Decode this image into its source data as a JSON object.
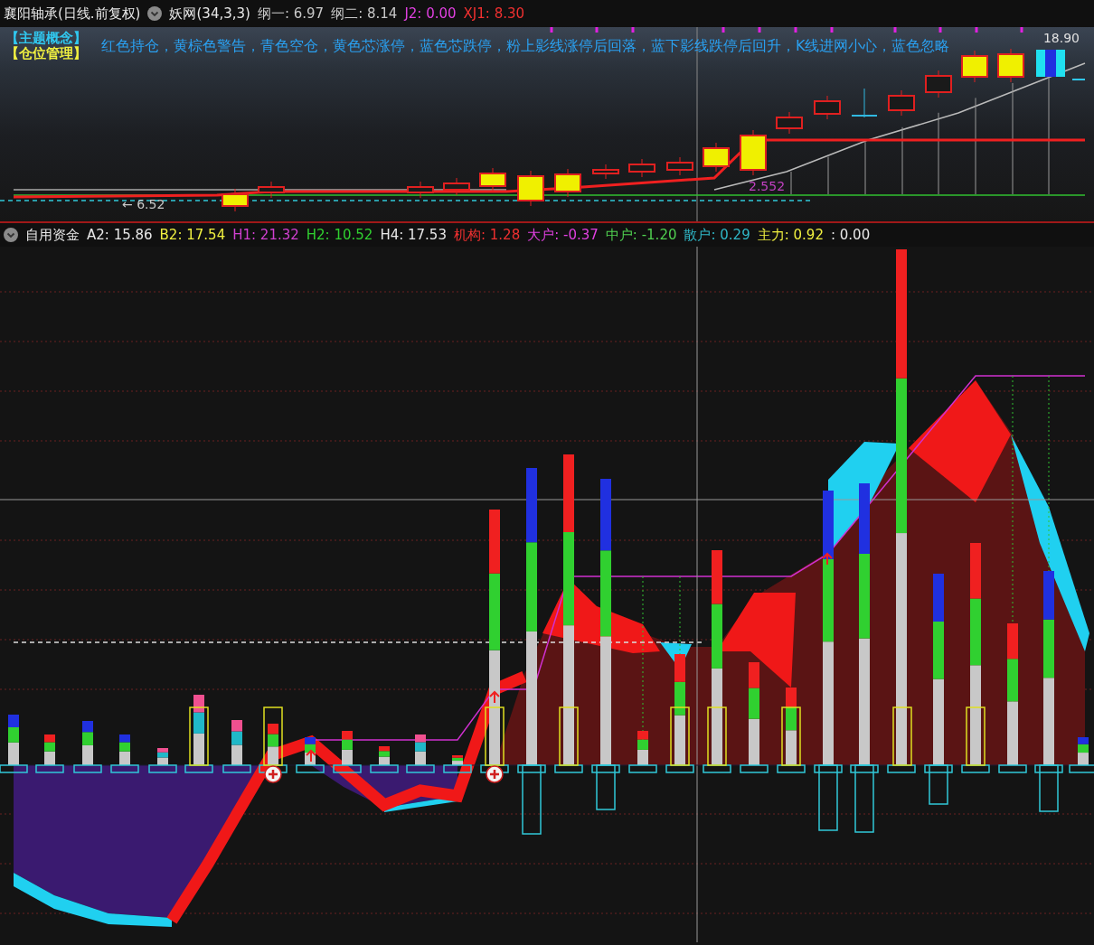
{
  "header": {
    "stock": "襄阳轴承(日线.前复权)",
    "indicator": "妖网(34,3,3)",
    "values": [
      {
        "text": "纲一: 6.97",
        "color": "#c8c8c8"
      },
      {
        "text": "纲二: 8.14",
        "color": "#c8c8c8"
      },
      {
        "text": "J2: 0.00",
        "color": "#e040e0"
      },
      {
        "text": "XJ1: 8.30",
        "color": "#f03030"
      }
    ]
  },
  "price_pane": {
    "legend_tags": [
      {
        "text": "【主题概念】",
        "color": "#30c8f0"
      },
      {
        "text": "【仓位管理】",
        "color": "#f0f040"
      }
    ],
    "legend": "红色持仓，黄棕色警告，青色空仓，黄色芯涨停，蓝色芯跌停，粉上影线涨停后回落，蓝下影线跌停后回升，K线进网小心，蓝色忽略",
    "labels": [
      {
        "kind": "high",
        "text": "18.90"
      },
      {
        "kind": "level",
        "text": "2.552"
      },
      {
        "kind": "low",
        "text": "← 6.52"
      }
    ]
  },
  "indicator_pane": {
    "title": "自用资金",
    "values": [
      {
        "text": "A2: 15.86",
        "color": "#e8e8e8"
      },
      {
        "text": "B2: 17.54",
        "color": "#f0f040"
      },
      {
        "text": "H1: 21.32",
        "color": "#d040d0"
      },
      {
        "text": "H2: 10.52",
        "color": "#30d030"
      },
      {
        "text": "H4: 17.53",
        "color": "#e8e8e8"
      },
      {
        "text": "机构: 1.28",
        "color": "#f03030"
      },
      {
        "text": "大户: -0.37",
        "color": "#e040e0"
      },
      {
        "text": "中户: -1.20",
        "color": "#50d050"
      },
      {
        "text": "散户: 0.29",
        "color": "#30b8c8"
      },
      {
        "text": "主力: 0.92",
        "color": "#f0f040"
      },
      {
        "text": ": 0.00",
        "color": "#e8e8e8"
      }
    ]
  }
}
